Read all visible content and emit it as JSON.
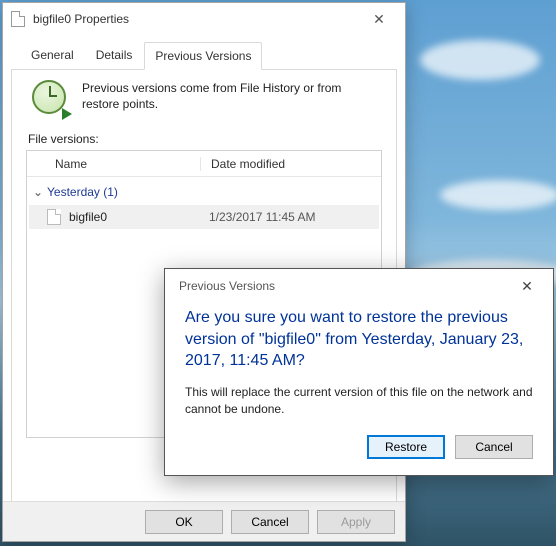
{
  "window": {
    "title": "bigfile0 Properties"
  },
  "tabs": {
    "general": "General",
    "details": "Details",
    "previous": "Previous Versions"
  },
  "intro": "Previous versions come from File History or from restore points.",
  "file_versions_label": "File versions:",
  "columns": {
    "name": "Name",
    "date": "Date modified"
  },
  "group": {
    "label": "Yesterday (1)"
  },
  "file": {
    "name": "bigfile0",
    "date": "1/23/2017 11:45 AM"
  },
  "buttons": {
    "ok": "OK",
    "cancel": "Cancel",
    "apply": "Apply"
  },
  "dialog": {
    "title": "Previous Versions",
    "main": "Are you sure you want to restore the previous version of \"bigfile0\" from Yesterday, January 23, 2017, 11:45 AM?",
    "sub": "This will replace the current version of this file on the network and cannot be undone.",
    "restore": "Restore",
    "cancel": "Cancel"
  }
}
